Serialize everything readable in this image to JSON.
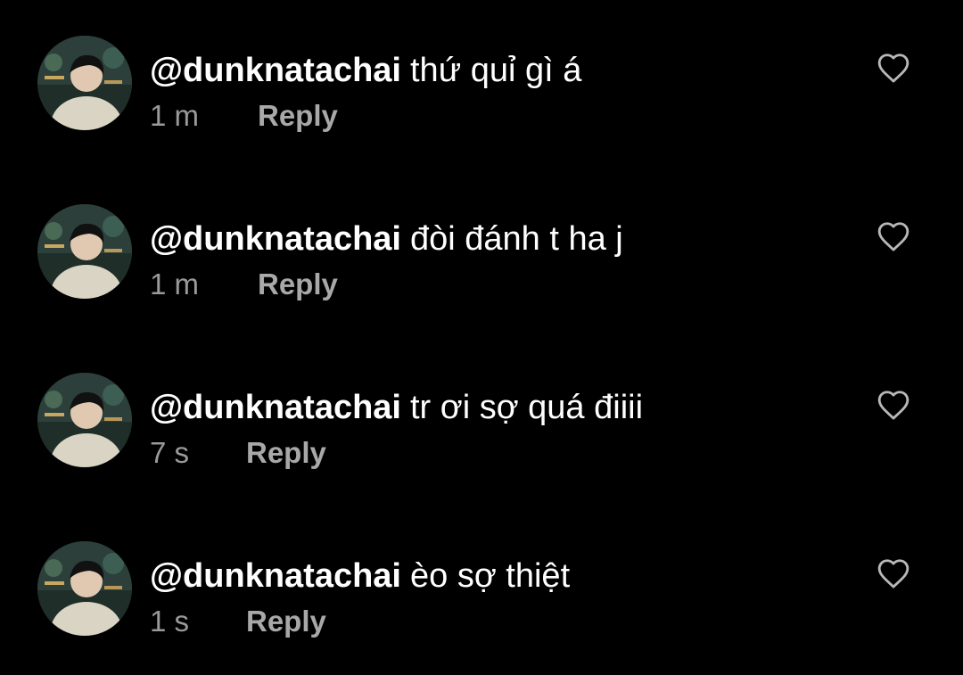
{
  "comments": [
    {
      "username": "@dunknatachai",
      "text": "thứ quỉ gì á",
      "time": "1 m",
      "reply_label": "Reply"
    },
    {
      "username": "@dunknatachai",
      "text": "đòi đánh t ha j",
      "time": "1 m",
      "reply_label": "Reply"
    },
    {
      "username": "@dunknatachai",
      "text": "tr ơi sợ quá điiii",
      "time": "7 s",
      "reply_label": "Reply"
    },
    {
      "username": "@dunknatachai",
      "text": "èo sợ thiệt",
      "time": "1 s",
      "reply_label": "Reply"
    }
  ],
  "icons": {
    "like": "heart-outline-icon",
    "avatar": "user-avatar"
  },
  "colors": {
    "background": "#000000",
    "text": "#ffffff",
    "meta": "#9a9a9a",
    "reply": "#a8a8a8"
  }
}
